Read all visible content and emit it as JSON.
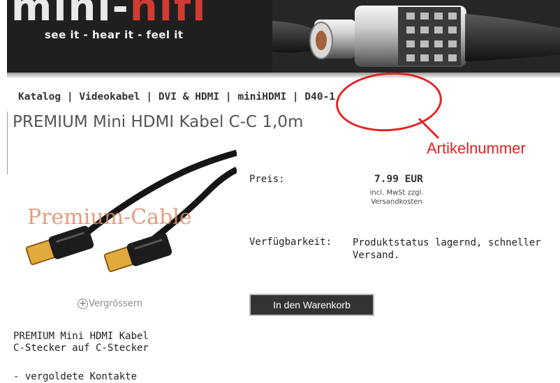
{
  "header": {
    "logo_text_main": "mini-",
    "logo_text_accent": "hifi",
    "slogan": "see it - hear it - feel it"
  },
  "breadcrumb": {
    "items": [
      "Katalog",
      "Videokabel",
      "DVI & HDMI",
      "miniHDMI",
      "D40-1"
    ],
    "separator": " | "
  },
  "product": {
    "title": "PREMIUM Mini HDMI Kabel C-C 1,0m",
    "image_watermark": "Premium-Cable",
    "enlarge_label": "Vergrössern",
    "price_label": "Preis:",
    "price": "7.99 EUR",
    "price_note_line1": "incl. MwSt zzgl.",
    "price_note_line2": "Versandkosten",
    "availability_label": "Verfügbarkeit:",
    "availability_line1": "Produktstatus lagernd, schneller",
    "availability_line2": "Versand.",
    "cart_button": "In den Warenkorb",
    "desc_line1": "PREMIUM Mini HDMI Kabel",
    "desc_line2": "C-Stecker auf C-Stecker",
    "bullet1": "- vergoldete Kontakte"
  },
  "annotation": {
    "label": "Artikelnummer",
    "color": "#e32222"
  }
}
